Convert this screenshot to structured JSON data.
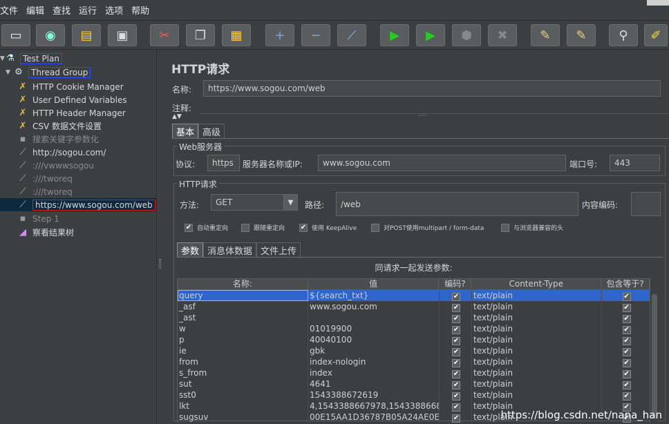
{
  "menu": [
    "文件",
    "编辑",
    "查找",
    "运行",
    "选项",
    "帮助"
  ],
  "toolbar": [
    {
      "icon": "new-icon",
      "glyph": "▭"
    },
    {
      "icon": "templates-icon",
      "glyph": "◉"
    },
    {
      "icon": "open-icon",
      "glyph": "▤"
    },
    {
      "icon": "save-icon",
      "glyph": "▣"
    },
    {
      "icon": "cut-icon",
      "glyph": "✂"
    },
    {
      "icon": "copy-icon",
      "glyph": "❐"
    },
    {
      "icon": "paste-icon",
      "glyph": "▦"
    },
    {
      "icon": "expand-icon",
      "glyph": "+"
    },
    {
      "icon": "collapse-icon",
      "glyph": "−"
    },
    {
      "icon": "toggle-icon",
      "glyph": "⟋"
    },
    {
      "icon": "start-icon",
      "glyph": "▶"
    },
    {
      "icon": "start-no-pause-icon",
      "glyph": "▶"
    },
    {
      "icon": "stop-icon",
      "glyph": "⬢"
    },
    {
      "icon": "shutdown-icon",
      "glyph": "✖"
    },
    {
      "icon": "clear-icon",
      "glyph": "✎"
    },
    {
      "icon": "clear-all-icon",
      "glyph": "✎"
    },
    {
      "icon": "search-icon",
      "glyph": "⚲"
    },
    {
      "icon": "reset-search-icon",
      "glyph": "✐"
    }
  ],
  "tree": [
    {
      "label": "Test Plan",
      "icon": "flask-icon",
      "glyph": "⚗",
      "indent": 0,
      "expander": "▼",
      "box": "blue"
    },
    {
      "label": "Thread Group",
      "icon": "gear-icon",
      "glyph": "⚙",
      "indent": 1,
      "expander": "▼",
      "box": "blue"
    },
    {
      "label": "HTTP Cookie Manager",
      "icon": "wrench-icon",
      "glyph": "✗",
      "indent": 2
    },
    {
      "label": "User Defined Variables",
      "icon": "wrench-icon",
      "glyph": "✗",
      "indent": 2
    },
    {
      "label": "HTTP Header Manager",
      "icon": "wrench-icon",
      "glyph": "✗",
      "indent": 2
    },
    {
      "label": "CSV 数据文件设置",
      "icon": "wrench-icon",
      "glyph": "✗",
      "indent": 2
    },
    {
      "label": "搜索关键字参数化",
      "icon": "module-icon",
      "glyph": "▪",
      "indent": 2,
      "disabled": true
    },
    {
      "label": "http://sogou.com/",
      "icon": "pipette-icon",
      "glyph": "⟋",
      "indent": 2
    },
    {
      "label": ":///vwwwsogou",
      "icon": "pipette-icon",
      "glyph": "⟋",
      "indent": 2,
      "disabled": true
    },
    {
      "label": ":///tworeq",
      "icon": "pipette-icon",
      "glyph": "⟋",
      "indent": 2,
      "disabled": true
    },
    {
      "label": ":///tworeq",
      "icon": "pipette-icon",
      "glyph": "⟋",
      "indent": 2,
      "disabled": true
    },
    {
      "label": "https://www.sogou.com/web",
      "icon": "pipette-icon",
      "glyph": "⟋",
      "indent": 2,
      "selected": true,
      "box": "red"
    },
    {
      "label": "Step 1",
      "icon": "module-icon",
      "glyph": "▪",
      "indent": 2,
      "disabled": true
    },
    {
      "label": "察看结果树",
      "icon": "chart-icon",
      "glyph": "◢",
      "indent": 2
    }
  ],
  "panel": {
    "title": "HTTP请求",
    "name_label": "名称:",
    "name_value": "https://www.sogou.com/web",
    "comment_label": "注释:",
    "tabs": [
      "基本",
      "高级"
    ],
    "web_server_title": "Web服务器",
    "protocol_label": "协议:",
    "protocol_value": "https",
    "server_label": "服务器名称或IP:",
    "server_value": "www.sogou.com",
    "port_label": "端口号:",
    "port_value": "443",
    "http_request_title": "HTTP请求",
    "method_label": "方法:",
    "method_value": "GET",
    "path_label": "路径:",
    "path_value": "/web",
    "encoding_label": "内容编码:",
    "checkboxes": [
      {
        "label": "自动重定向",
        "checked": true
      },
      {
        "label": "跟随重定向",
        "checked": false
      },
      {
        "label": "使用 KeepAlive",
        "checked": true
      },
      {
        "label": "对POST使用multipart / form-data",
        "checked": false
      },
      {
        "label": "与浏览器兼容的头",
        "checked": false
      }
    ],
    "sub_tabs": [
      "参数",
      "消息体数据",
      "文件上传"
    ],
    "table_caption": "同请求一起发送参数:",
    "columns": [
      "名称:",
      "值",
      "编码?",
      "Content-Type",
      "包含等于?"
    ],
    "rows": [
      {
        "name": "query",
        "value": "${search_txt}",
        "encode": true,
        "type": "text/plain",
        "include": true
      },
      {
        "name": "_asf",
        "value": "www.sogou.com",
        "encode": true,
        "type": "text/plain",
        "include": true
      },
      {
        "name": "_ast",
        "value": "",
        "encode": true,
        "type": "text/plain",
        "include": true
      },
      {
        "name": "w",
        "value": "01019900",
        "encode": true,
        "type": "text/plain",
        "include": true
      },
      {
        "name": "p",
        "value": "40040100",
        "encode": true,
        "type": "text/plain",
        "include": true
      },
      {
        "name": "ie",
        "value": "gbk",
        "encode": true,
        "type": "text/plain",
        "include": true
      },
      {
        "name": "from",
        "value": "index-nologin",
        "encode": true,
        "type": "text/plain",
        "include": true
      },
      {
        "name": "s_from",
        "value": "index",
        "encode": true,
        "type": "text/plain",
        "include": true
      },
      {
        "name": "sut",
        "value": "4641",
        "encode": true,
        "type": "text/plain",
        "include": true
      },
      {
        "name": "sst0",
        "value": "1543388672619",
        "encode": true,
        "type": "text/plain",
        "include": true
      },
      {
        "name": "lkt",
        "value": "4,1543388667978,1543388668...",
        "encode": true,
        "type": "text/plain",
        "include": true
      },
      {
        "name": "sugsuv",
        "value": "00E15AA1D36787B05A24AE0E...",
        "encode": true,
        "type": "text/plain",
        "include": true
      }
    ]
  },
  "watermark": "https://blog.csdn.net/nana_han"
}
